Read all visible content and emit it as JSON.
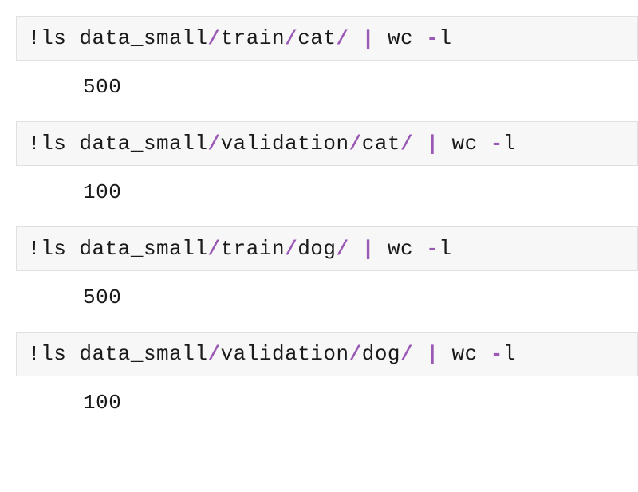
{
  "cells": [
    {
      "bang": "!",
      "cmd1": "ls",
      "s": " ",
      "p1": "data_small",
      "sl1": "/",
      "p2": "train",
      "sl2": "/",
      "p3": "cat",
      "sl3": "/",
      "pipe": "|",
      "cmd2": "wc",
      "dash": "-",
      "flag": "l",
      "output": "500"
    },
    {
      "bang": "!",
      "cmd1": "ls",
      "s": " ",
      "p1": "data_small",
      "sl1": "/",
      "p2": "validation",
      "sl2": "/",
      "p3": "cat",
      "sl3": "/",
      "pipe": "|",
      "cmd2": "wc",
      "dash": "-",
      "flag": "l",
      "output": "100"
    },
    {
      "bang": "!",
      "cmd1": "ls",
      "s": " ",
      "p1": "data_small",
      "sl1": "/",
      "p2": "train",
      "sl2": "/",
      "p3": "dog",
      "sl3": "/",
      "pipe": "|",
      "cmd2": "wc",
      "dash": "-",
      "flag": "l",
      "output": "500"
    },
    {
      "bang": "!",
      "cmd1": "ls",
      "s": " ",
      "p1": "data_small",
      "sl1": "/",
      "p2": "validation",
      "sl2": "/",
      "p3": "dog",
      "sl3": "/",
      "pipe": "|",
      "cmd2": "wc",
      "dash": "-",
      "flag": "l",
      "output": "100"
    }
  ]
}
